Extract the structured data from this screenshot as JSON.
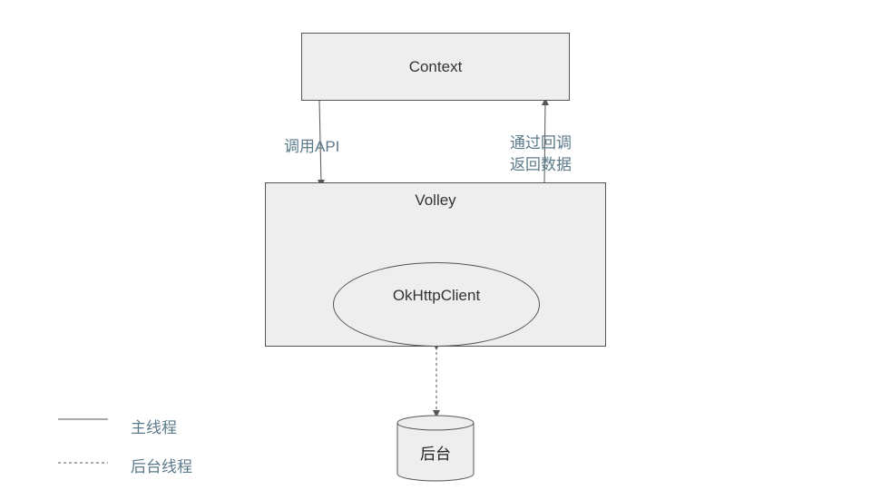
{
  "nodes": {
    "context": "Context",
    "volley": "Volley",
    "okhttp": "OkHttpClient",
    "backend": "后台"
  },
  "edges": {
    "call_api": "调用API",
    "return_line1": "通过回调",
    "return_line2": "返回数据"
  },
  "legend": {
    "main_thread": "主线程",
    "background_thread": "后台线程"
  },
  "colors": {
    "box_fill": "#eeeeee",
    "stroke": "#555555",
    "label_text": "#5c7a8a"
  }
}
